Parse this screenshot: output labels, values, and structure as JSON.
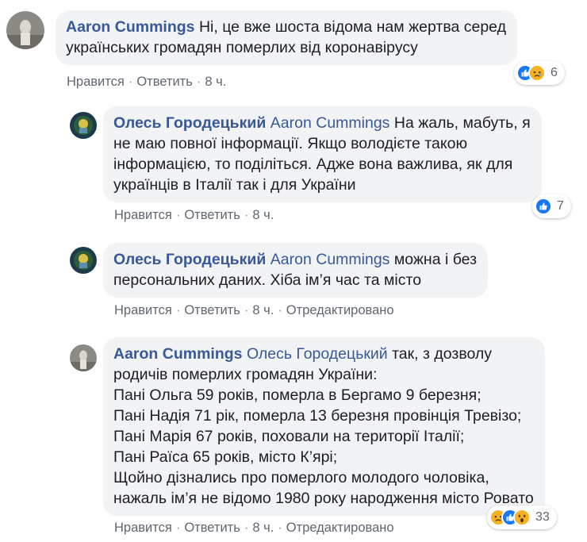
{
  "comments": [
    {
      "author": "Aaron Cummings",
      "mention": "",
      "lines": [
        "Ні, це вже шоста відома нам жертва серед",
        "українських громадян померлих від коронавірусу"
      ],
      "actions": {
        "like": "Нравится",
        "reply": "Ответить",
        "time": "8 ч.",
        "edited": ""
      },
      "reactions": {
        "icons": [
          "like-reaction-icon",
          "sad-reaction-icon"
        ],
        "count": "6"
      }
    },
    {
      "author": "Олесь Городецький",
      "mention": "Aaron Cummings",
      "lines": [
        "На жаль, мабуть, я",
        "не маю повної інформації. Якщо володієте такою",
        "інформацією, то поділіться. Адже вона важлива, як для",
        "українців в Італії так і для України"
      ],
      "actions": {
        "like": "Нравится",
        "reply": "Ответить",
        "time": "8 ч.",
        "edited": ""
      },
      "reactions": {
        "icons": [
          "like-reaction-icon"
        ],
        "count": "7"
      }
    },
    {
      "author": "Олесь Городецький",
      "mention": "Aaron Cummings",
      "lines": [
        "можна і без",
        "персональних даних. Хіба ім’я час та місто"
      ],
      "actions": {
        "like": "Нравится",
        "reply": "Ответить",
        "time": "8 ч.",
        "edited": "Отредактировано"
      },
      "reactions": null
    },
    {
      "author": "Aaron Cummings",
      "mention": "Олесь Городецький",
      "lines": [
        "так, з дозволу",
        "родичів померлих громадян України:",
        "Пані Ольга 59 років, померла в Бергамо 9 березня;",
        "Пані Надія 71 рік, померла 13 березня провінція Тревізо;",
        "Пані Марія 67 років, поховали на території Італії;",
        "Пані Раїса 65 років, місто К’ярі;",
        "Щойно дізнались про померлого молодого чоловіка,",
        "нажаль ім’я не відомо 1980 року народження місто Ровато"
      ],
      "actions": {
        "like": "Нравится",
        "reply": "Ответить",
        "time": "8 ч.",
        "edited": "Отредактировано"
      },
      "reactions": {
        "icons": [
          "sad-reaction-icon",
          "like-reaction-icon",
          "wow-reaction-icon"
        ],
        "count": "33"
      }
    }
  ],
  "colors": {
    "link": "#385898",
    "bubble": "#f2f3f5",
    "meta": "#606770",
    "like": "#1877f2",
    "emoji": "#f7b125"
  }
}
